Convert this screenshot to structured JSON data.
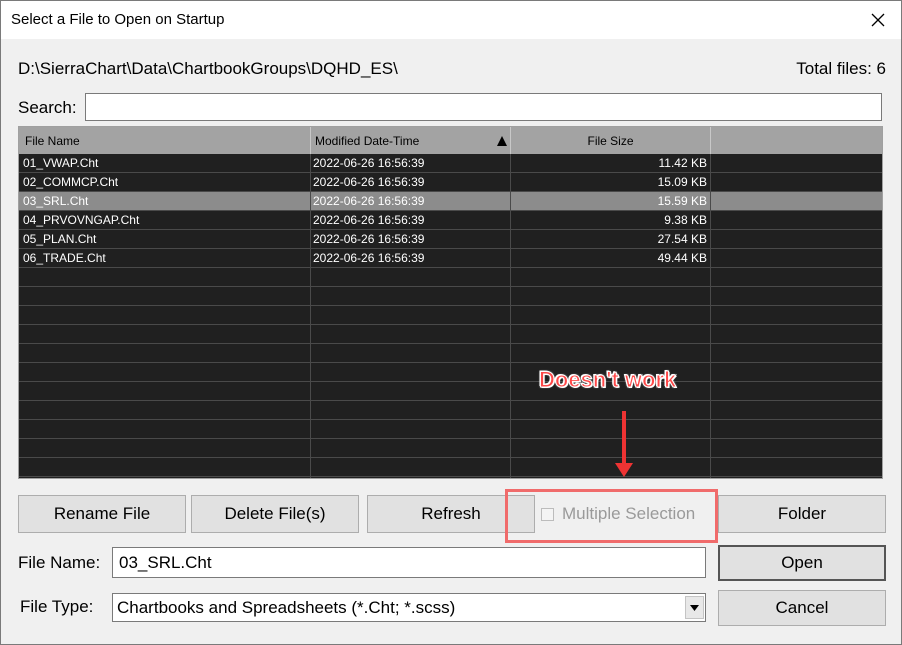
{
  "window": {
    "title": "Select a File to Open on Startup"
  },
  "path": "D:\\SierraChart\\Data\\ChartbookGroups\\DQHD_ES\\",
  "total_files": "Total files: 6",
  "search": {
    "label": "Search:",
    "value": ""
  },
  "columns": [
    "File Name",
    "Modified Date-Time",
    "File Size"
  ],
  "sort_column": "Modified Date-Time",
  "files": [
    {
      "name": "01_VWAP.Cht",
      "modified": "2022-06-26  16:56:39",
      "size": "11.42 KB"
    },
    {
      "name": "02_COMMCP.Cht",
      "modified": "2022-06-26  16:56:39",
      "size": "15.09 KB"
    },
    {
      "name": "03_SRL.Cht",
      "modified": "2022-06-26  16:56:39",
      "size": "15.59 KB"
    },
    {
      "name": "04_PRVOVNGAP.Cht",
      "modified": "2022-06-26  16:56:39",
      "size": "9.38 KB"
    },
    {
      "name": "05_PLAN.Cht",
      "modified": "2022-06-26  16:56:39",
      "size": "27.54 KB"
    },
    {
      "name": "06_TRADE.Cht",
      "modified": "2022-06-26  16:56:39",
      "size": "49.44 KB"
    }
  ],
  "selected_index": 2,
  "buttons": {
    "rename": "Rename File",
    "delete": "Delete File(s)",
    "refresh": "Refresh",
    "folder": "Folder",
    "open": "Open",
    "cancel": "Cancel"
  },
  "multiple_selection": {
    "label": "Multiple Selection",
    "checked": false,
    "enabled": false
  },
  "file_name": {
    "label": "File Name:",
    "value": "03_SRL.Cht"
  },
  "file_type": {
    "label": "File Type:",
    "value": "Chartbooks and Spreadsheets (*.Cht; *.scss)"
  },
  "annotation": {
    "text": "Doesn't work",
    "color": "#ff4848"
  },
  "colors": {
    "grid_bg": "#202020",
    "header_bg": "#a3a3a3",
    "selected_row": "#8c8c8c"
  }
}
